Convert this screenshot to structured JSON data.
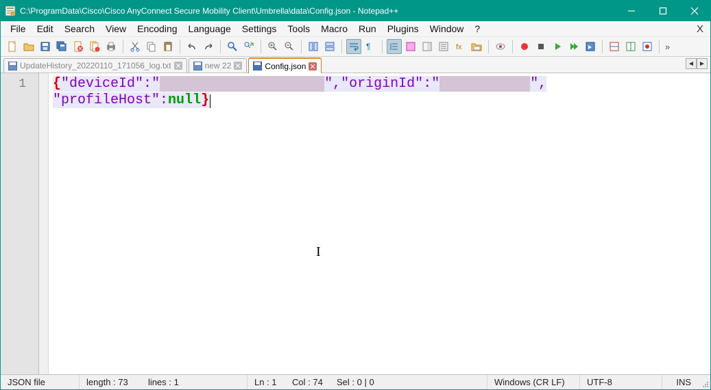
{
  "window": {
    "title": "C:\\ProgramData\\Cisco\\Cisco AnyConnect Secure Mobility Client\\Umbrella\\data\\Config.json - Notepad++"
  },
  "menu": {
    "file": "File",
    "edit": "Edit",
    "search": "Search",
    "view": "View",
    "encoding": "Encoding",
    "language": "Language",
    "settings": "Settings",
    "tools": "Tools",
    "macro": "Macro",
    "run": "Run",
    "plugins": "Plugins",
    "window": "Window",
    "help": "?",
    "close_x": "X"
  },
  "tabs": {
    "t1": "UpdateHistory_20220110_171056_log.txt",
    "t2": "new 22",
    "t3": "Config.json"
  },
  "editor": {
    "line_number": "1",
    "content_tokens": {
      "open_brace": "{",
      "key1": "\"deviceId\"",
      "colon": ":",
      "val1_open": "\"",
      "val1_redacted": "                    ",
      "val1_close": "\"",
      "comma": ",",
      "key2": "\"originId\"",
      "val2_open": "\"",
      "val2_redacted": "           ",
      "val2_close": "\"",
      "key3": "\"profileHost\"",
      "null_val": "null",
      "close_brace": "}"
    }
  },
  "status": {
    "file_type": "JSON file",
    "length": "length : 73",
    "lines": "lines : 1",
    "ln": "Ln : 1",
    "col": "Col : 74",
    "sel": "Sel : 0 | 0",
    "eol": "Windows (CR LF)",
    "encoding": "UTF-8",
    "mode": "INS"
  }
}
